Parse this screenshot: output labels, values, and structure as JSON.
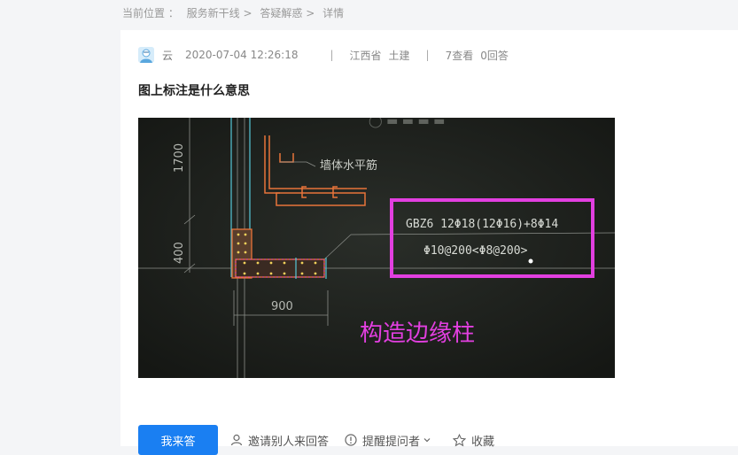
{
  "breadcrumb": {
    "label": "当前位置 ：",
    "items": [
      "服务新干线",
      "答疑解惑",
      "详情"
    ],
    "separator": ">"
  },
  "question": {
    "author": "云",
    "time": "2020-07-04 12:26:18",
    "region": "江西省",
    "category": "土建",
    "views": "7查看",
    "answers": "0回答",
    "title": "图上标注是什么意思"
  },
  "drawing": {
    "dim_1700": "1700",
    "dim_400": "400",
    "dim_900": "900",
    "wall_label": "墙体水平筋",
    "gbz_line1": "GBZ6  12Φ18(12Φ16)+8Φ14",
    "gbz_line2": "Φ10@200<Φ8@200>",
    "overlay_text": "构造边缘柱",
    "colors": {
      "magenta": "#e23fe0",
      "orange": "#e8743a",
      "cyan": "#56c8d8"
    }
  },
  "actions": {
    "answer_label": "我来答",
    "invite_label": "邀请别人来回答",
    "remind_label": "提醒提问者",
    "favorite_label": "收藏"
  },
  "colors": {
    "primary": "#1a7ff2",
    "page_bg": "#f4f5f7"
  }
}
